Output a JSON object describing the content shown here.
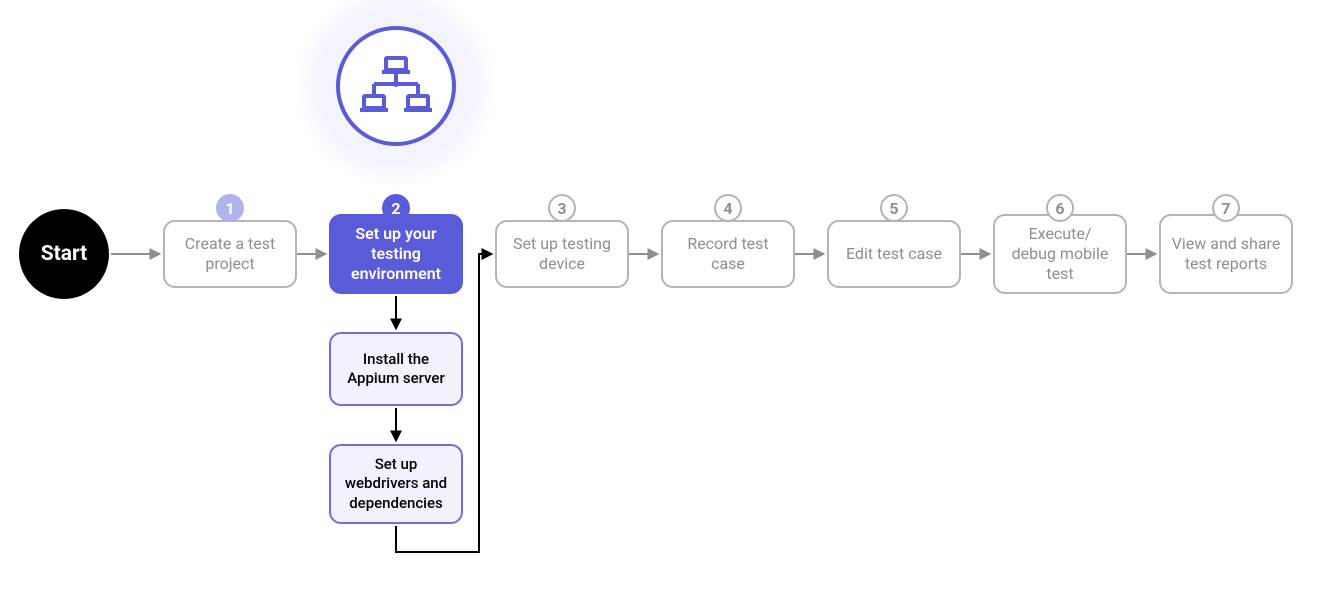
{
  "start": {
    "label": "Start"
  },
  "steps": [
    {
      "num": "1",
      "label": "Create a test project",
      "active": false
    },
    {
      "num": "2",
      "label": "Set up your testing environment",
      "active": true
    },
    {
      "num": "3",
      "label": "Set up testing device",
      "active": false
    },
    {
      "num": "4",
      "label": "Record test case",
      "active": false
    },
    {
      "num": "5",
      "label": "Edit test case",
      "active": false
    },
    {
      "num": "6",
      "label": "Execute/ debug mobile test",
      "active": false
    },
    {
      "num": "7",
      "label": "View and share test reports",
      "active": false
    }
  ],
  "substeps": [
    {
      "label": "Install the Appium server"
    },
    {
      "label": "Set up webdrivers and dependencies"
    }
  ],
  "icon": {
    "name": "network-hierarchy-icon"
  },
  "colors": {
    "primary": "#5a5bd9",
    "primary_soft": "#b2b2ed",
    "substep_fill": "#f2f1fd",
    "inactive_border": "#b4b4b4",
    "inactive_text": "#8f8f8f"
  }
}
